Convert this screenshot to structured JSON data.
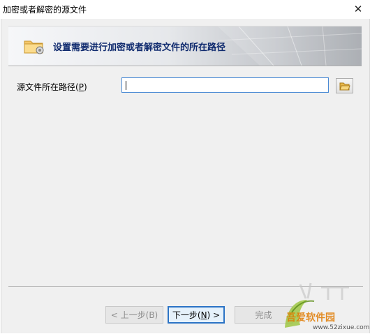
{
  "window": {
    "title": "加密或者解密的源文件",
    "close_glyph": "✕"
  },
  "banner": {
    "heading": "设置需要进行加密或者解密文件的所在路径",
    "icon": "folder-gear-icon"
  },
  "form": {
    "path_label_prefix": "源文件所在路径(",
    "path_label_mnemonic": "P",
    "path_label_suffix": ")",
    "path_value": "",
    "browse_icon": "open-folder-icon"
  },
  "buttons": {
    "back": "< 上一步(B)",
    "next_prefix": "下一步(",
    "next_mnemonic": "N",
    "next_suffix": ") >",
    "finish": "完成"
  },
  "watermark": {
    "text": "吾爱软件园",
    "url": "www.52zixue.com"
  },
  "colors": {
    "accent": "#2b73c5",
    "banner_text": "#0f2a6e",
    "folder": "#f4c76b"
  }
}
